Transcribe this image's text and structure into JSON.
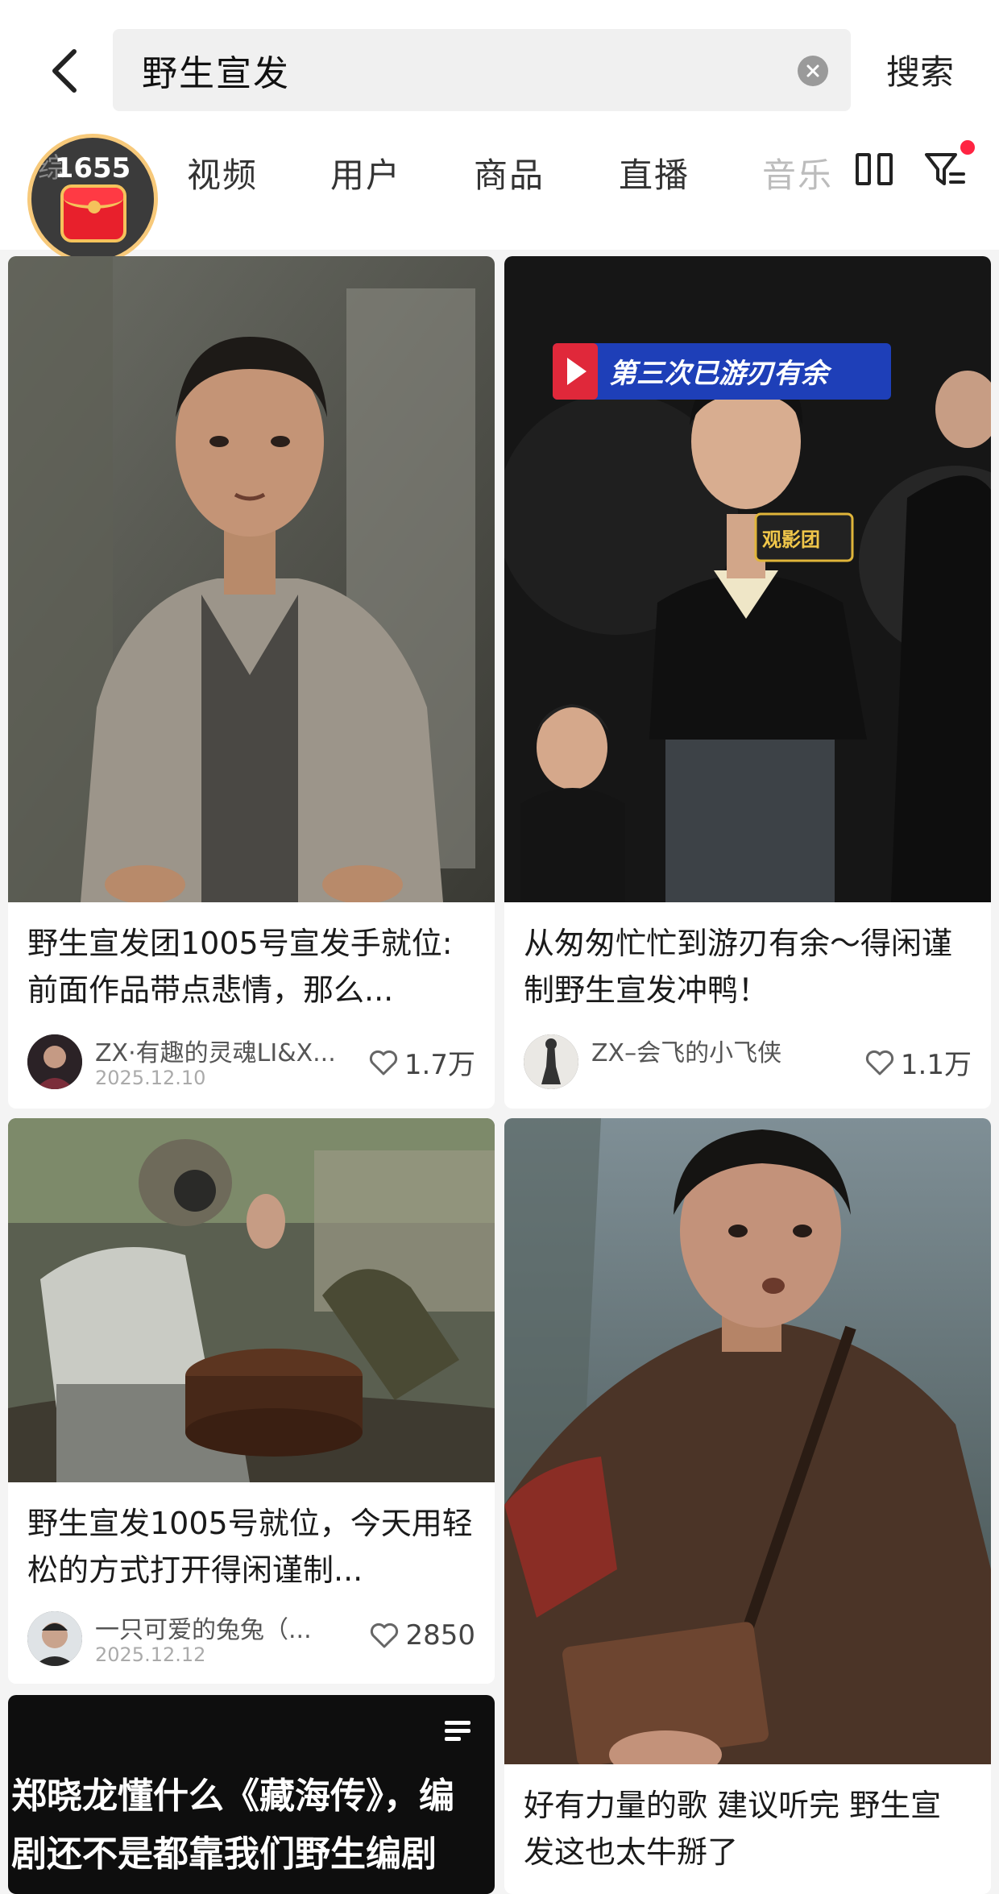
{
  "search": {
    "query": "野生宣发",
    "button_label": "搜索"
  },
  "tabs": [
    {
      "label": "视频",
      "faded": false
    },
    {
      "label": "用户",
      "faded": false
    },
    {
      "label": "商品",
      "faded": false
    },
    {
      "label": "直播",
      "faded": false
    },
    {
      "label": "音乐",
      "faded": true
    }
  ],
  "red_packet": {
    "count": "1655",
    "partial_text": "综"
  },
  "cards": [
    {
      "title": "野生宣发团1005号宣发手就位: 前面作品带点悲情，那么...",
      "author": "ZX·有趣的灵魂LI&X...",
      "date": "2025.12.10",
      "likes": "1.7万"
    },
    {
      "title": "从匆匆忙忙到游刃有余～得闲谨制野生宣发冲鸭！",
      "author": "ZX–会飞的小飞侠",
      "date": "",
      "likes": "1.1万",
      "banner_text": "第三次已游刃有余",
      "mic_text": "观影团"
    },
    {
      "title": "野生宣发1005号就位，今天用轻松的方式打开得闲谨制...",
      "author": "一只可爱的兔兔（...",
      "date": "2025.12.12",
      "likes": "2850"
    },
    {
      "title": "好有力量的歌 建议听完 野生宣发这也太牛掰了",
      "author": "",
      "date": "",
      "likes": ""
    },
    {
      "title": "郑晓龙懂什么《藏海传》，编剧还不是都靠我们野生编剧",
      "author": "",
      "date": "",
      "likes": ""
    }
  ],
  "colors": {
    "accent": "#ff2442",
    "page_bg": "#f4f4f4",
    "card_bg": "#ffffff"
  }
}
